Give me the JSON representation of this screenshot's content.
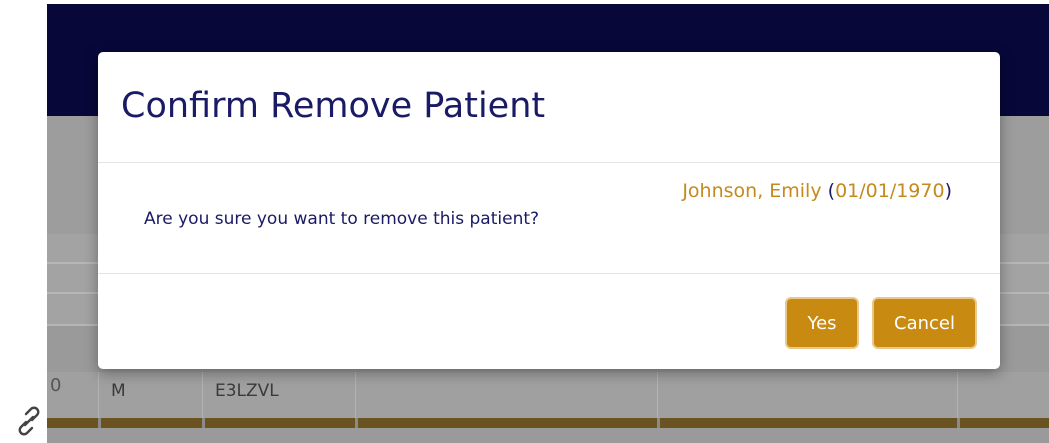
{
  "background_table": {
    "row": {
      "gender": "M",
      "code": "E3LZVL",
      "truncated_left_char": "0"
    }
  },
  "dialog": {
    "title": "Confirm Remove Patient",
    "patient": {
      "name": "Johnson, Emily",
      "dob": "01/01/1970",
      "open_paren": "(",
      "close_paren": ")"
    },
    "message": "Are you sure you want to remove this patient?",
    "buttons": {
      "yes": "Yes",
      "cancel": "Cancel"
    }
  },
  "icons": {
    "bottom_left": "link-icon"
  },
  "colors": {
    "title": "#1a1a66",
    "accent": "#c98a12",
    "patient_text": "#c48a1e",
    "header_bg": "#07073a"
  }
}
